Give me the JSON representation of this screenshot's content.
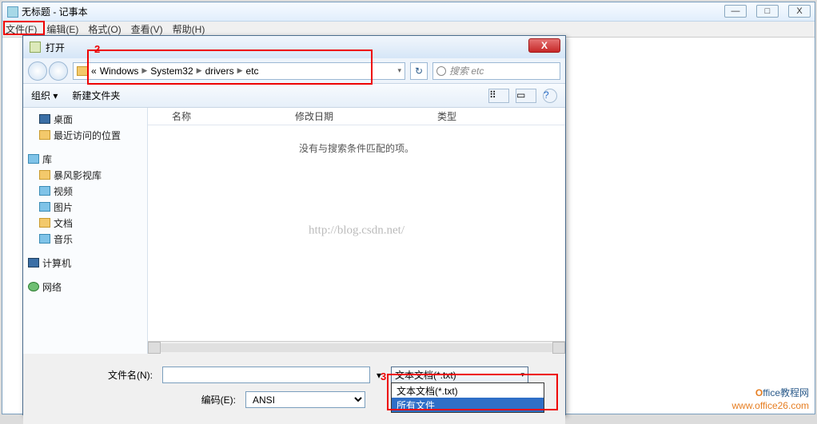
{
  "notepad": {
    "title": "无标题 - 记事本",
    "menus": [
      "文件(F)",
      "编辑(E)",
      "格式(O)",
      "查看(V)",
      "帮助(H)"
    ]
  },
  "window_controls": {
    "min": "—",
    "max": "□",
    "close": "X"
  },
  "annotations": {
    "n2": "2",
    "n3": "3"
  },
  "dialog": {
    "title": "打开",
    "close_x": "X",
    "breadcrumb": {
      "prefix": "«",
      "parts": [
        "Windows",
        "System32",
        "drivers",
        "etc"
      ],
      "sep": "▶"
    },
    "refresh": "↻",
    "search_placeholder": "搜索 etc",
    "toolbar": {
      "organize": "组织 ▾",
      "newfolder": "新建文件夹",
      "view": "⠿",
      "preview": "▭",
      "help": "?"
    },
    "tree": {
      "desktop": "桌面",
      "recent": "最近访问的位置",
      "library": "库",
      "storm": "暴风影视库",
      "video": "视频",
      "pictures": "图片",
      "docs": "文档",
      "music": "音乐",
      "computer": "计算机",
      "network": "网络"
    },
    "columns": {
      "name": "名称",
      "date": "修改日期",
      "type": "类型"
    },
    "empty": "没有与搜索条件匹配的项。",
    "watermark": "http://blog.csdn.net/",
    "filename_label": "文件名(N):",
    "filename_value": "",
    "encoding_label": "编码(E):",
    "encoding_value": "ANSI",
    "filter_selected": "文本文档(*.txt)",
    "filter_options": [
      "文本文档(*.txt)",
      "所有文件"
    ]
  },
  "logo": {
    "line1a": "O",
    "line1b": "ffice教程网",
    "line2": "www.office26.com"
  }
}
